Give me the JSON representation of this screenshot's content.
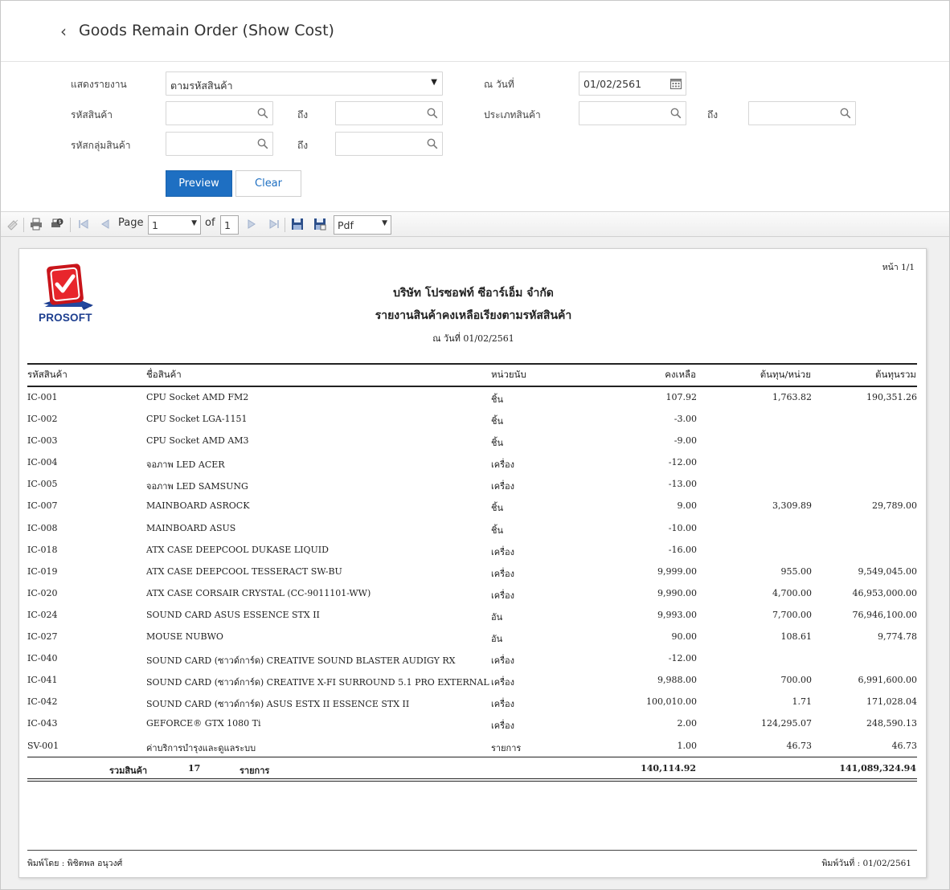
{
  "header": {
    "back_icon": "chevron-left-icon",
    "title": "Goods Remain Order (Show Cost)"
  },
  "filters": {
    "show_report_label": "แสดงรายงาน",
    "show_report_value": "ตามรหัสสินค้า",
    "as_of_label": "ณ วันที่",
    "as_of_value": "01/02/2561",
    "product_code_label": "รหัสสินค้า",
    "to_label": "ถึง",
    "product_type_label": "ประเภทสินค้า",
    "product_group_label": "รหัสกลุ่มสินค้า"
  },
  "buttons": {
    "preview": "Preview",
    "clear": "Clear"
  },
  "toolbar": {
    "page_label": "Page",
    "page_value": "1",
    "of_label": "of",
    "total_pages": "1",
    "export_format": "Pdf"
  },
  "report": {
    "logo_text": "PROSOFT",
    "page_no": "หน้า 1/1",
    "company": "บริษัท โปรซอฟท์ ซีอาร์เอ็ม จำกัด",
    "title": "รายงานสินค้าคงเหลือเรียงตามรหัสสินค้า",
    "date_line": "ณ วันที่ 01/02/2561",
    "columns": {
      "code": "รหัสสินค้า",
      "name": "ชื่อสินค้า",
      "unit": "หน่วยนับ",
      "remain": "คงเหลือ",
      "unit_cost": "ต้นทุน/หน่วย",
      "total_cost": "ต้นทุนรวม"
    },
    "rows": [
      {
        "code": "IC-001",
        "name": "CPU Socket AMD FM2",
        "unit": "ชิ้น",
        "remain": "107.92",
        "unit_cost": "1,763.82",
        "total_cost": "190,351.26"
      },
      {
        "code": "IC-002",
        "name": "CPU Socket LGA-1151",
        "unit": "ชิ้น",
        "remain": "-3.00",
        "unit_cost": "",
        "total_cost": ""
      },
      {
        "code": "IC-003",
        "name": "CPU Socket AMD AM3",
        "unit": "ชิ้น",
        "remain": "-9.00",
        "unit_cost": "",
        "total_cost": ""
      },
      {
        "code": "IC-004",
        "name": "จอภาพ LED  ACER",
        "unit": "เครื่อง",
        "remain": "-12.00",
        "unit_cost": "",
        "total_cost": ""
      },
      {
        "code": "IC-005",
        "name": "จอภาพ LED SAMSUNG",
        "unit": "เครื่อง",
        "remain": "-13.00",
        "unit_cost": "",
        "total_cost": ""
      },
      {
        "code": "IC-007",
        "name": "MAINBOARD ASROCK",
        "unit": "ชิ้น",
        "remain": "9.00",
        "unit_cost": "3,309.89",
        "total_cost": "29,789.00"
      },
      {
        "code": "IC-008",
        "name": "MAINBOARD  ASUS",
        "unit": "ชิ้น",
        "remain": "-10.00",
        "unit_cost": "",
        "total_cost": ""
      },
      {
        "code": "IC-018",
        "name": "ATX CASE DEEPCOOL DUKASE LIQUID",
        "unit": "เครื่อง",
        "remain": "-16.00",
        "unit_cost": "",
        "total_cost": ""
      },
      {
        "code": "IC-019",
        "name": "ATX CASE DEEPCOOL TESSERACT SW-BU",
        "unit": "เครื่อง",
        "remain": "9,999.00",
        "unit_cost": "955.00",
        "total_cost": "9,549,045.00"
      },
      {
        "code": "IC-020",
        "name": "ATX CASE CORSAIR CRYSTAL (CC-9011101-WW)",
        "unit": "เครื่อง",
        "remain": "9,990.00",
        "unit_cost": "4,700.00",
        "total_cost": "46,953,000.00"
      },
      {
        "code": "IC-024",
        "name": "SOUND CARD ASUS ESSENCE STX II",
        "unit": "อัน",
        "remain": "9,993.00",
        "unit_cost": "7,700.00",
        "total_cost": "76,946,100.00"
      },
      {
        "code": "IC-027",
        "name": "MOUSE NUBWO",
        "unit": "อัน",
        "remain": "90.00",
        "unit_cost": "108.61",
        "total_cost": "9,774.78"
      },
      {
        "code": "IC-040",
        "name": "SOUND CARD (ซาวด์การ์ด) CREATIVE SOUND BLASTER AUDIGY RX",
        "unit": "เครื่อง",
        "remain": "-12.00",
        "unit_cost": "",
        "total_cost": ""
      },
      {
        "code": "IC-041",
        "name": "SOUND CARD (ซาวด์การ์ด) CREATIVE X-FI SURROUND 5.1 PRO EXTERNAL",
        "unit": "เครื่อง",
        "remain": "9,988.00",
        "unit_cost": "700.00",
        "total_cost": "6,991,600.00"
      },
      {
        "code": "IC-042",
        "name": "SOUND CARD (ซาวด์การ์ด) ASUS ESTX II ESSENCE STX II",
        "unit": "เครื่อง",
        "remain": "100,010.00",
        "unit_cost": "1.71",
        "total_cost": "171,028.04"
      },
      {
        "code": "IC-043",
        "name": "GEFORCE® GTX 1080 Ti",
        "unit": "เครื่อง",
        "remain": "2.00",
        "unit_cost": "124,295.07",
        "total_cost": "248,590.13"
      },
      {
        "code": "SV-001",
        "name": "ค่าบริการบำรุงและดูแลระบบ",
        "unit": "รายการ",
        "remain": "1.00",
        "unit_cost": "46.73",
        "total_cost": "46.73"
      }
    ],
    "summary": {
      "label": "รวมสินค้า",
      "count": "17",
      "unit": "รายการ",
      "remain_total": "140,114.92",
      "cost_total": "141,089,324.94"
    },
    "footer": {
      "printed_by": "พิมพ์โดย :  พิชิตพล อนุวงศ์",
      "printed_date": "พิมพ์วันที่ :  01/02/2561"
    }
  }
}
